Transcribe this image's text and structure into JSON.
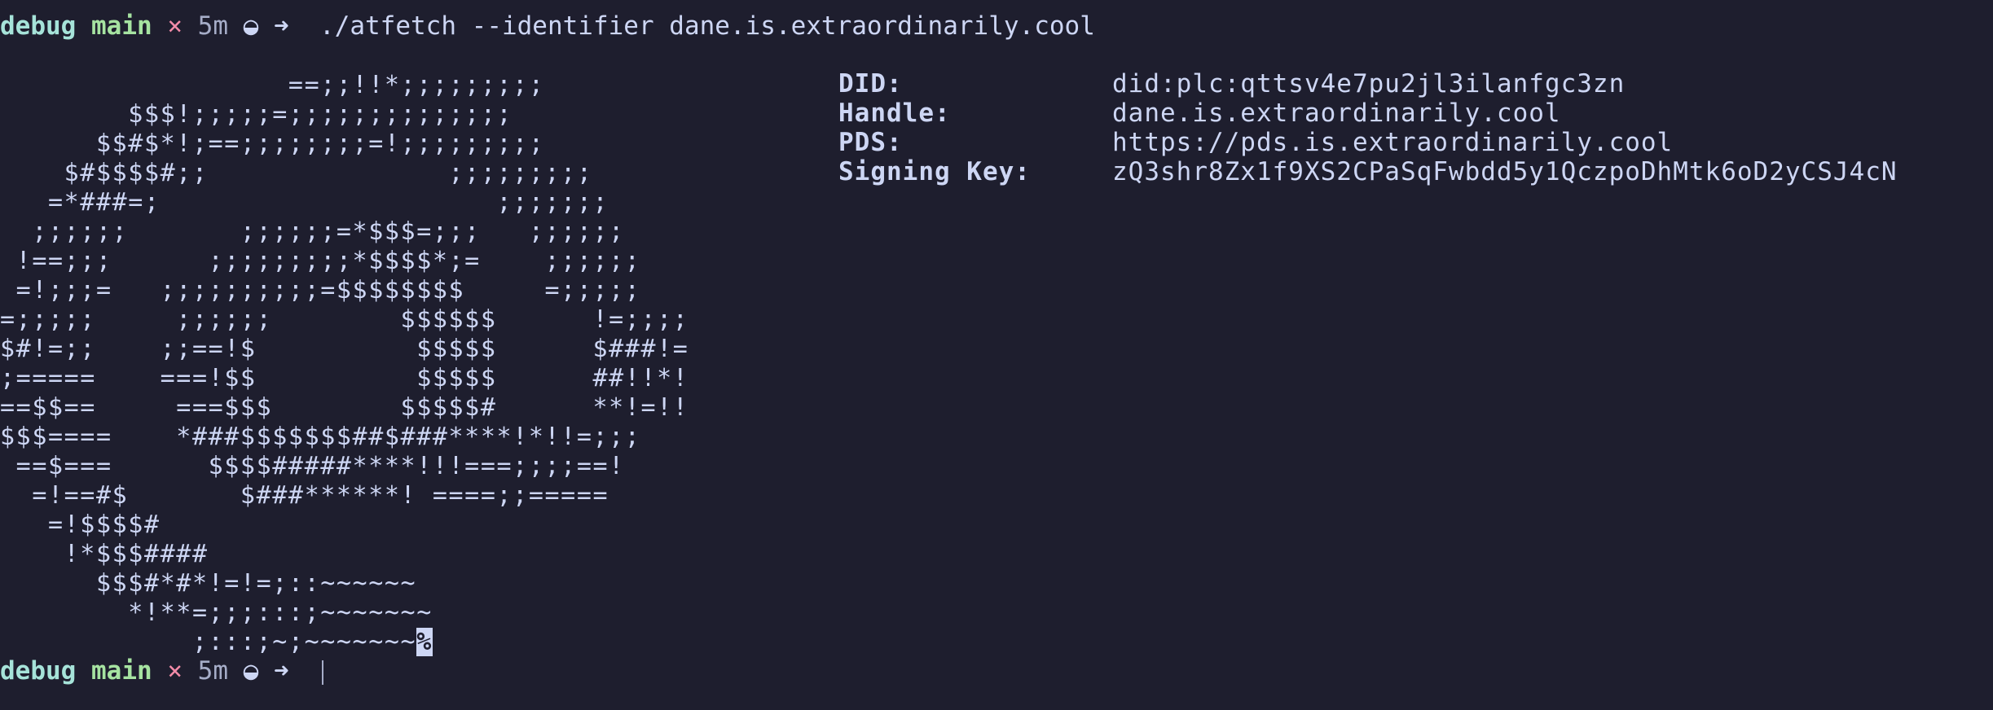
{
  "prompt": {
    "host": "debug",
    "branch": "main",
    "dirty": "×",
    "elapsed": "5m",
    "glyph": "◒",
    "arrow": "➜"
  },
  "command": "./atfetch --identifier dane.is.extraordinarily.cool",
  "ascii_art": [
    "                  ==;;!!*;;;;;;;;;",
    "        $$$!;;;;;=;;;;;;;;;;;;;;",
    "      $$#$*!;==;;;;;;;;=!;;;;;;;;;",
    "    $#$$$$#;;               ;;;;;;;;;",
    "   =*###=;                     ;;;;;;;",
    "  ;;;;;;       ;;;;;;=*$$$=;;;   ;;;;;;",
    " !==;;;      ;;;;;;;;;*$$$$*;=    ;;;;;;",
    " =!;;;=   ;;;;;;;;;;=$$$$$$$$     =;;;;;",
    "=;;;;;     ;;;;;;        $$$$$$      !=;;;;",
    "$#!=;;    ;;==!$          $$$$$      $###!=",
    ";=====    ===!$$          $$$$$      ##!!*!",
    "==$$==     ===$$$        $$$$$#      **!=!!",
    "$$$====    *###$$$$$$$##$###****!*!!=;;;",
    " ==$===      $$$$#####****!!!===;;;;==!",
    "  =!==#$       $###******! ====;;=====",
    "   =!$$$$#",
    "    !*$$$####",
    "      $$$#*#*!=!=;::~~~~~~",
    "        *!**=;;;:::;~~~~~~~",
    "            ;:::;~;~~~~~~~"
  ],
  "ascii_art_eol": "%",
  "profile": {
    "rows": [
      {
        "key": "DID:",
        "value": "did:plc:qttsv4e7pu2jl3ilanfgc3zn"
      },
      {
        "key": "Handle:",
        "value": "dane.is.extraordinarily.cool"
      },
      {
        "key": "PDS:",
        "value": "https://pds.is.extraordinarily.cool"
      },
      {
        "key": "Signing Key:",
        "value": "zQ3shr8Zx1f9XS2CPaSqFwbdd5y1QczpoDhMtk6oD2yCSJ4cN"
      }
    ]
  },
  "colors": {
    "background": "#1e1e2e",
    "foreground": "#cdd6f4",
    "host": "#a6e3d9",
    "branch": "#a6e3a1",
    "dirty": "#f38ba8",
    "dim": "#a6adc8"
  }
}
